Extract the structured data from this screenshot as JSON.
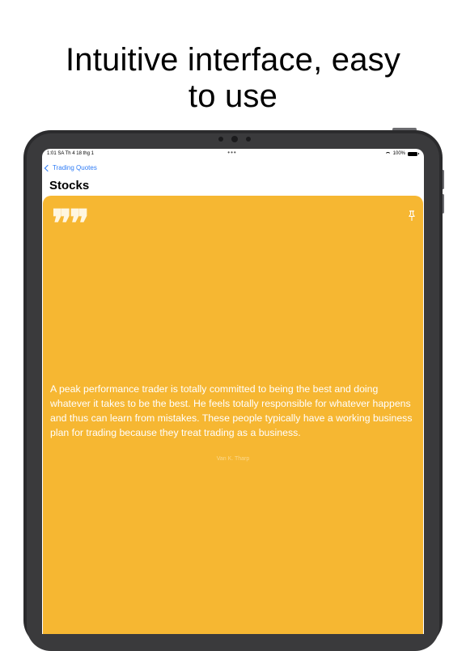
{
  "headline": {
    "line1": "Intuitive interface, easy",
    "line2": "to use"
  },
  "status_bar": {
    "time_date": "1:01 SA   Th 4 18 thg 1",
    "center_dots": "•••",
    "battery": "100%"
  },
  "nav": {
    "back_label": "Trading Quotes",
    "title": "Stocks"
  },
  "quote": {
    "text": "A peak performance trader is totally committed to being the best and doing whatever it takes to be the best. He feels totally responsible for whatever happens and thus can learn from mistakes. These people typically have a working business plan for trading because they treat trading as a business.",
    "author": "Van K. Tharp",
    "quote_mark": "❞❞",
    "card_color": "#f6b732"
  },
  "icons": {
    "quote": "quote-icon",
    "pin": "pin-icon",
    "back": "chevron-left-icon",
    "wifi": "wifi-icon",
    "battery": "battery-icon"
  }
}
